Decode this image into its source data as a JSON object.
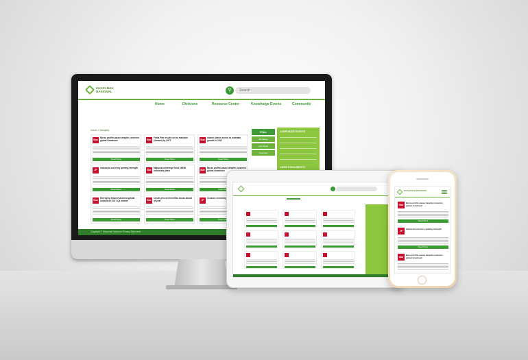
{
  "colors": {
    "accent": "#3d9b35",
    "accent_light": "#8dc63f",
    "footer": "#2f7d2a",
    "news_badge": "#c8102e"
  },
  "site": {
    "logo_text": "KHAZANAH NASIONAL",
    "search_placeholder": "Search",
    "nav": [
      "Home",
      "Divisions",
      "Resource Center",
      "Knowledge Events",
      "Community"
    ],
    "breadcrumb": "Home > Malaysia",
    "filter_label": "Filter",
    "filter_options": [
      "All Status",
      "Last Week",
      "Yesterday"
    ],
    "read_more": "Read More",
    "cards": [
      {
        "badge": "Star",
        "title": "Bursa profits pause despite concerns global slowdown"
      },
      {
        "badge": "Star",
        "title": "Felda Pan results set to maintain (Variant) by 2017"
      },
      {
        "badge": "Star",
        "title": "Islamic banks sector to maintain growth in 2017"
      },
      {
        "badge": "JP",
        "title": "Indonesia currency gaining strength"
      },
      {
        "badge": "Star",
        "title": "Malaysia sovereign fund 1MDB Indonesia plans"
      },
      {
        "badge": "Star",
        "title": "Bursa profits pause despite concerns global slowdown"
      },
      {
        "badge": "Star",
        "title": "Emerging Indonesia boost global outlook on 2017 Q1 market"
      },
      {
        "badge": "Star",
        "title": "Crude prices intensifies boost ahead of year"
      },
      {
        "badge": "JP",
        "title": "Crosses economy growth"
      }
    ],
    "sidebar_heading_1": "CORPORATE EVENTS",
    "sidebar_heading_2": "LATEST DOCUMENTS",
    "footer_text": "Copyright © Khazanah Nasional. Privacy Statement"
  },
  "phone": {
    "logo_text": "KHAZANAH NASIONAL",
    "cards": [
      {
        "badge": "Star",
        "title": "Bursa profits pause despite concerns global slowdown"
      },
      {
        "badge": "JP",
        "title": "Indonesia currency gaining strength"
      },
      {
        "badge": "Star",
        "title": "Bursa profits pause despite concerns global slowdown"
      }
    ],
    "read_more": "Read More"
  },
  "device": {
    "apple_glyph": ""
  }
}
